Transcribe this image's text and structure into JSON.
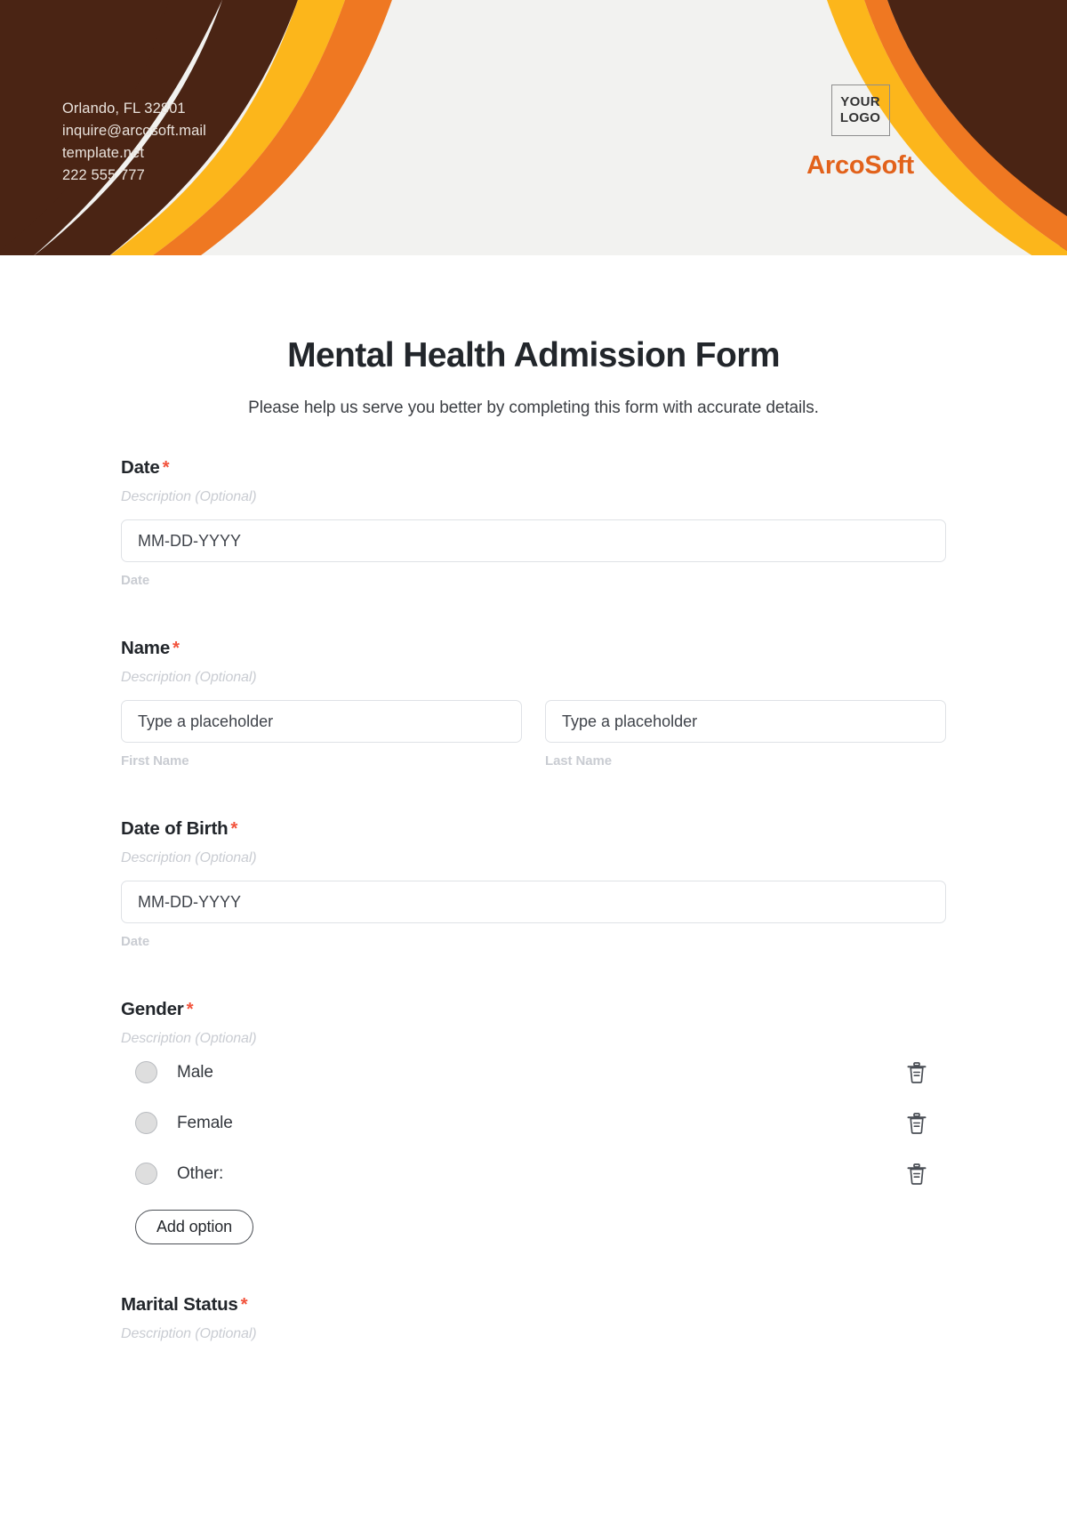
{
  "header": {
    "contact_lines": [
      "Orlando, FL 32801",
      "inquire@arcosoft.mail",
      "template.net",
      "222 555 777"
    ],
    "logo_line1": "YOUR",
    "logo_line2": "LOGO",
    "brand": "ArcoSoft",
    "colors": {
      "dark_brown": "#4a2414",
      "orange": "#ef7822",
      "yellow": "#fcb61b",
      "panel": "#f2f2f0",
      "brand_text": "#e2621b"
    }
  },
  "form": {
    "title": "Mental Health Admission Form",
    "subtitle": "Please help us serve you better by completing this form with accurate details.",
    "required_marker": "*",
    "description_placeholder": "Description (Optional)",
    "fields": [
      {
        "label": "Date",
        "description": "Description (Optional)",
        "inputs": [
          {
            "value": "MM-DD-YYYY",
            "sub_label": "Date"
          }
        ]
      },
      {
        "label": "Name",
        "description": "Description (Optional)",
        "inputs": [
          {
            "value": "Type a placeholder",
            "sub_label": "First Name"
          },
          {
            "value": "Type a placeholder",
            "sub_label": "Last Name"
          }
        ]
      },
      {
        "label": "Date of Birth",
        "description": "Description (Optional)",
        "inputs": [
          {
            "value": "MM-DD-YYYY",
            "sub_label": "Date"
          }
        ]
      },
      {
        "label": "Gender",
        "description": "Description (Optional)",
        "options": [
          "Male",
          "Female",
          "Other:"
        ],
        "add_option_label": "Add option",
        "delete_icon": "trash-icon"
      },
      {
        "label": "Marital Status",
        "description": "Description (Optional)"
      }
    ]
  }
}
